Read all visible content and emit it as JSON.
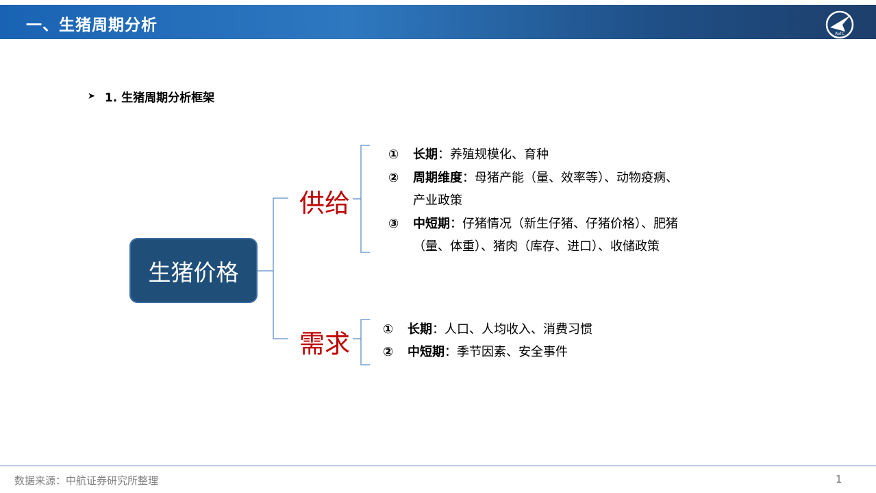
{
  "header": {
    "title": "一、生猪周期分析"
  },
  "subheading": {
    "text": "1. 生猪周期分析框架"
  },
  "center": {
    "label": "生猪价格"
  },
  "supply": {
    "label": "供给",
    "items": [
      {
        "num": "①",
        "key": "长期",
        "sep": "：",
        "text": "养殖规模化、育种"
      },
      {
        "num": "②",
        "key": "周期维度",
        "sep": "：",
        "text": "母猪产能（量、效率等）、动物疫病、"
      },
      {
        "cont": "产业政策"
      },
      {
        "num": "③",
        "key": "中短期",
        "sep": "：",
        "text": "仔猪情况（新生仔猪、仔猪价格）、肥猪"
      },
      {
        "cont": "（量、体重）、猪肉（库存、进口）、收储政策"
      }
    ]
  },
  "demand": {
    "label": "需求",
    "items": [
      {
        "num": "①",
        "key": "长期",
        "sep": "：",
        "text": "人口、人均收入、消费习惯"
      },
      {
        "num": "②",
        "key": "中短期",
        "sep": "：",
        "text": "季节因素、安全事件"
      }
    ]
  },
  "footer": {
    "source": "数据来源：中航证券研究所整理",
    "page": "1"
  },
  "colors": {
    "header_blue": "#2e78c0",
    "box_navy": "#1f4e79",
    "label_red": "#c00000"
  }
}
